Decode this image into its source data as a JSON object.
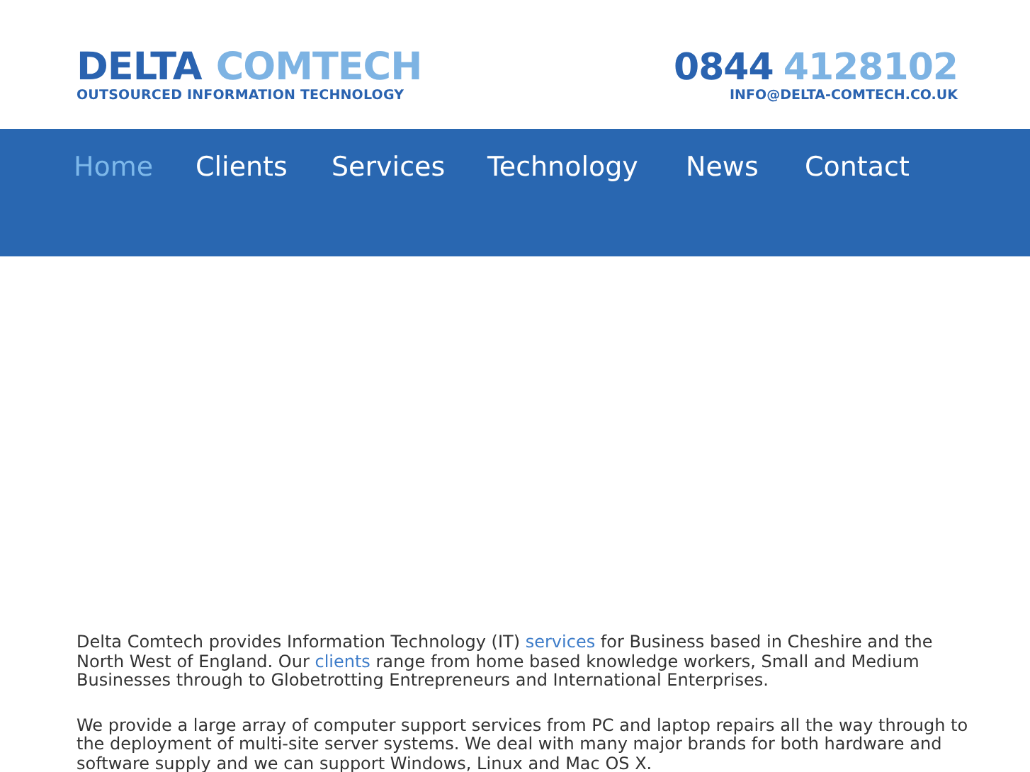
{
  "logo": {
    "words": [
      "DELTA",
      "COMTECH"
    ],
    "tagline": "OUTSOURCED INFORMATION TECHNOLOGY"
  },
  "contact": {
    "phone": [
      "0844",
      "4128102"
    ],
    "email": "INFO@DELTA-COMTECH.CO.UK"
  },
  "nav": [
    {
      "label": "Home",
      "selected": true
    },
    {
      "label": "Clients",
      "selected": false
    },
    {
      "label": "Services",
      "selected": false
    },
    {
      "label": "Technology",
      "selected": false
    },
    {
      "label": "News",
      "selected": false
    },
    {
      "label": "Contact",
      "selected": false
    }
  ],
  "paragraphs": [
    [
      {
        "kind": "text",
        "text": "Delta Comtech provides Information Technology (IT) "
      },
      {
        "kind": "link",
        "text": "services"
      },
      {
        "kind": "text",
        "text": " for Business based in Cheshire and the North West of England. Our "
      },
      {
        "kind": "link",
        "text": "clients"
      },
      {
        "kind": "text",
        "text": " range from home based knowledge workers, Small and Medium Businesses through to Globetrotting Entrepreneurs and International Enterprises."
      }
    ],
    [
      {
        "kind": "text",
        "text": "We provide a large array of computer support services from PC and laptop repairs all the way through to the deployment of multi-site server systems. We deal with many major brands for both hardware and software supply and we can support Windows, Linux and Mac OS X."
      }
    ]
  ]
}
